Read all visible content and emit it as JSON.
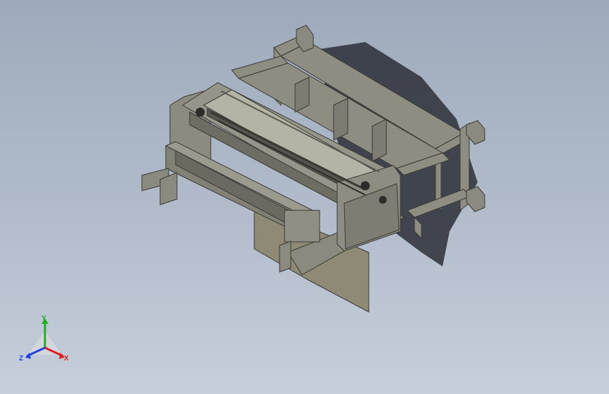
{
  "viewport": {
    "background_top": "#9eaabb",
    "background_bottom": "#c6cfdb"
  },
  "model": {
    "frame_color": "#8d8d82",
    "dark_color": "#3c3c36",
    "shadow_color": "#2d2f37"
  },
  "triad": {
    "x_label": "X",
    "y_label": "Y",
    "z_label": "Z",
    "x_color": "#e02020",
    "y_color": "#22b022",
    "z_color": "#2040e0"
  }
}
